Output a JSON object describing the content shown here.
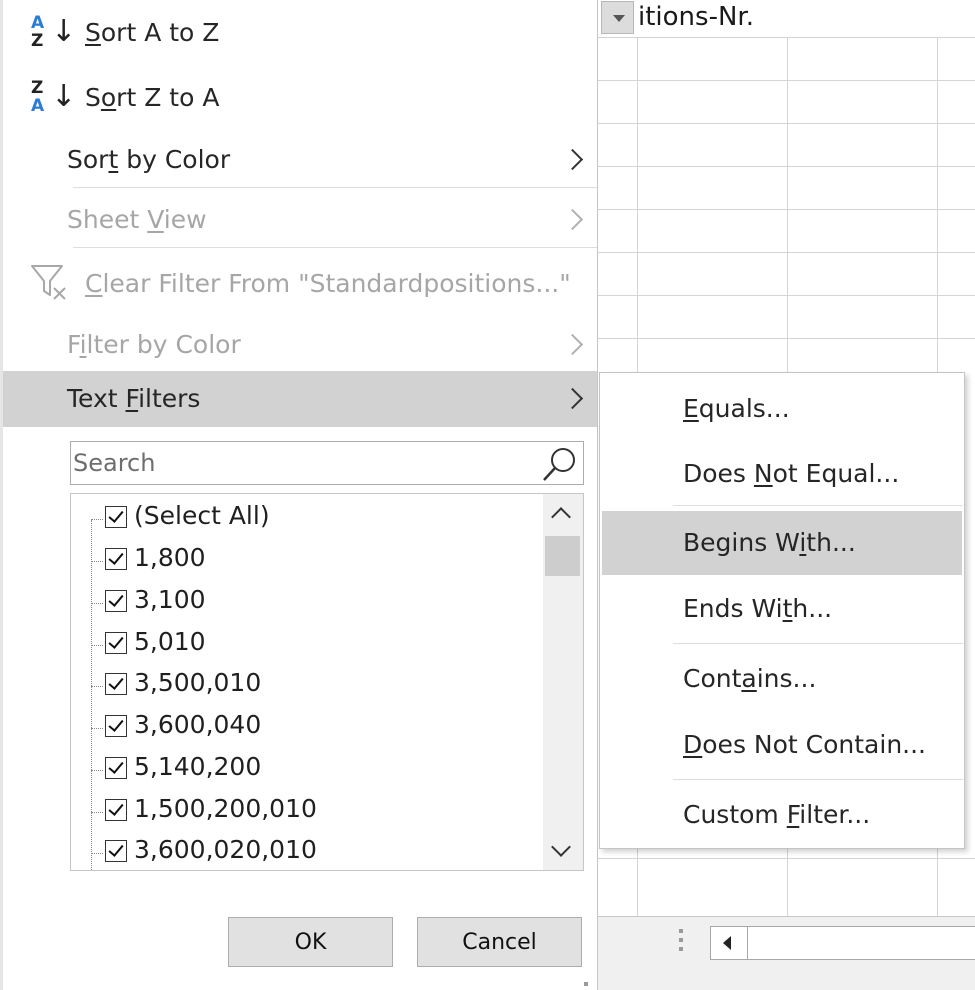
{
  "sheet": {
    "column_header": "itions-Nr."
  },
  "menu": {
    "sort_az": {
      "icon_top": "A",
      "icon_bottom": "Z",
      "arrow": "↓",
      "pre": "",
      "key": "S",
      "post": "ort A to Z"
    },
    "sort_za": {
      "icon_top": "Z",
      "icon_bottom": "A",
      "arrow": "↓",
      "pre": "S",
      "key": "o",
      "post": "rt Z to A"
    },
    "sort_by_color": {
      "pre": "Sor",
      "key": "t",
      "post": " by Color"
    },
    "sheet_view": {
      "pre": "Sheet ",
      "key": "V",
      "post": "iew"
    },
    "clear_filter": {
      "pre": "",
      "key": "C",
      "post": "lear Filter From \"Standardpositions...\""
    },
    "filter_by_color": {
      "pre": "F",
      "key": "i",
      "post": "lter by Color"
    },
    "text_filters": {
      "pre": "Text ",
      "key": "F",
      "post": "ilters"
    }
  },
  "search": {
    "placeholder": "Search"
  },
  "list_items": [
    "(Select All)",
    "1,800",
    "3,100",
    "5,010",
    "3,500,010",
    "3,600,040",
    "5,140,200",
    "1,500,200,010",
    "3,600,020,010"
  ],
  "buttons": {
    "ok": "OK",
    "cancel": "Cancel"
  },
  "submenu": {
    "equals": {
      "pre": "",
      "key": "E",
      "post": "quals..."
    },
    "does_not_equal": {
      "pre": "Does ",
      "key": "N",
      "post": "ot Equal..."
    },
    "begins_with": {
      "pre": "Begins W",
      "key": "i",
      "post": "th..."
    },
    "ends_with": {
      "pre": "Ends Wi",
      "key": "t",
      "post": "h..."
    },
    "contains": {
      "pre": "Cont",
      "key": "a",
      "post": "ins..."
    },
    "does_not_contain": {
      "pre": "",
      "key": "D",
      "post": "oes Not Contain..."
    },
    "custom_filter": {
      "pre": "Custom ",
      "key": "F",
      "post": "ilter..."
    }
  },
  "colors": {
    "hover": "#d2d2d2",
    "disabled_text": "#a6a6a6",
    "sort_icon_blue": "#2b7cd3"
  }
}
